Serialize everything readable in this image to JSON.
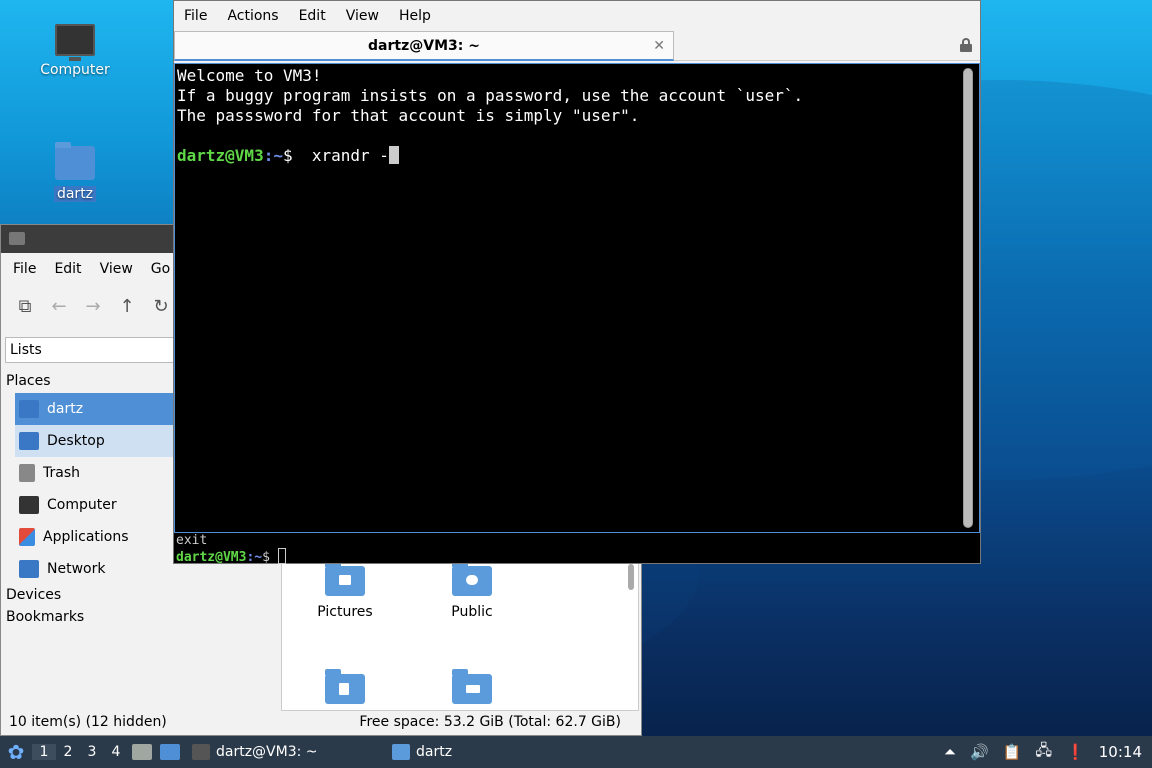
{
  "desktop": {
    "icons": [
      {
        "label": "Computer",
        "icon": "computer-icon"
      },
      {
        "label": "dartz",
        "icon": "home-folder-icon"
      }
    ]
  },
  "file_manager": {
    "menu": [
      "File",
      "Edit",
      "View",
      "Go"
    ],
    "side_mode": "Lists",
    "places_header": "Places",
    "places": [
      {
        "label": "dartz",
        "icon": "home-icon",
        "color": "#4f8fd6"
      },
      {
        "label": "Desktop",
        "icon": "desktop-icon",
        "color": "#4f8fd6"
      },
      {
        "label": "Trash",
        "icon": "trash-icon",
        "color": "#888888"
      },
      {
        "label": "Computer",
        "icon": "computer-icon",
        "color": "#333333"
      },
      {
        "label": "Applications",
        "icon": "applications-icon",
        "color": "#e24b3b"
      },
      {
        "label": "Network",
        "icon": "network-icon",
        "color": "#4f8fd6"
      }
    ],
    "devices_header": "Devices",
    "bookmarks_header": "Bookmarks",
    "files": [
      {
        "label": "Pictures",
        "icon": "pictures-folder-icon"
      },
      {
        "label": "Public",
        "icon": "public-folder-icon"
      },
      {
        "label": "",
        "icon": "templates-folder-icon"
      },
      {
        "label": "",
        "icon": "videos-folder-icon"
      }
    ],
    "status_left": "10 item(s) (12 hidden)",
    "status_right": "Free space: 53.2 GiB (Total: 62.7 GiB)"
  },
  "terminal": {
    "menu": [
      "File",
      "Actions",
      "Edit",
      "View",
      "Help"
    ],
    "tab_title": "dartz@VM3: ~",
    "lines": [
      "Welcome to VM3!",
      "If a buggy program insists on a password, use the account `user`.",
      "The passsword for that account is simply \"user\"."
    ],
    "prompt_user": "dartz@VM3",
    "prompt_path": ":~",
    "prompt_symbol": "$",
    "command": "  xrandr -",
    "bottom_line1": "exit",
    "bottom_prompt_user": "dartz@VM3",
    "bottom_prompt_path": ":~",
    "bottom_prompt_symbol": "$ "
  },
  "taskbar": {
    "workspaces": [
      "1",
      "2",
      "3",
      "4"
    ],
    "tasks": [
      {
        "label": "dartz@VM3: ~",
        "icon": "terminal-icon"
      },
      {
        "label": "dartz",
        "icon": "folder-icon"
      }
    ],
    "clock": "10:14"
  }
}
